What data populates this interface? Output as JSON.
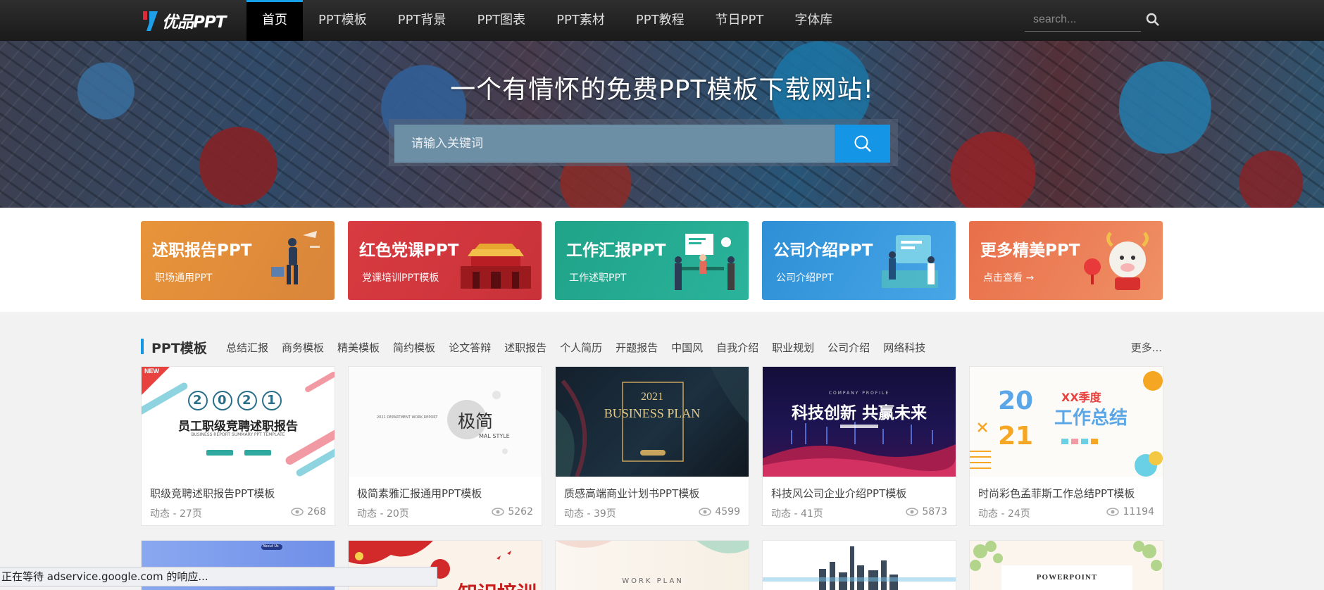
{
  "logo": {
    "text": "优品PPT"
  },
  "nav": {
    "items": [
      {
        "label": "首页"
      },
      {
        "label": "PPT模板"
      },
      {
        "label": "PPT背景"
      },
      {
        "label": "PPT图表"
      },
      {
        "label": "PPT素材"
      },
      {
        "label": "PPT教程"
      },
      {
        "label": "节日PPT"
      },
      {
        "label": "字体库"
      }
    ],
    "active_index": 0,
    "search_placeholder": "search..."
  },
  "hero": {
    "title": "一个有情怀的免费PPT模板下载网站!",
    "search_placeholder": "请输入关键词"
  },
  "banners": [
    {
      "title": "述职报告PPT",
      "subtitle": "职场通用PPT"
    },
    {
      "title": "红色党课PPT",
      "subtitle": "党课培训PPT模板"
    },
    {
      "title": "工作汇报PPT",
      "subtitle": "工作述职PPT"
    },
    {
      "title": "公司介绍PPT",
      "subtitle": "公司介绍PPT"
    },
    {
      "title": "更多精美PPT",
      "subtitle": "点击查看 →"
    }
  ],
  "section": {
    "title": "PPT模板",
    "tags": [
      "总结汇报",
      "商务模板",
      "精美模板",
      "简约模板",
      "论文答辩",
      "述职报告",
      "个人简历",
      "开题报告",
      "中国风",
      "自我介绍",
      "职业规划",
      "公司介绍",
      "网络科技"
    ],
    "more": "更多..."
  },
  "cards": [
    {
      "title": "职级竞聘述职报告PPT模板",
      "meta": "动态 - 27页",
      "views": "268",
      "thumb_text": {
        "badge": "NEW",
        "digits": [
          "2",
          "0",
          "2",
          "1"
        ],
        "heading": "员工职级竞聘述职报告",
        "sub": "BUSINESS REPORT SUMMARY PPT TEMPLATE"
      }
    },
    {
      "title": "极简素雅汇报通用PPT模板",
      "meta": "动态 - 20页",
      "views": "5262",
      "thumb_text": {
        "heading": "极简",
        "side": "MAL STYLE",
        "small": "2021 DEPARTMENT WORK REPORT"
      }
    },
    {
      "title": "质感高端商业计划书PPT模板",
      "meta": "动态 - 39页",
      "views": "4599",
      "thumb_text": {
        "year": "2021",
        "heading": "BUSINESS PLAN"
      }
    },
    {
      "title": "科技风公司企业介绍PPT模板",
      "meta": "动态 - 41页",
      "views": "5873",
      "thumb_text": {
        "small": "COMPANY PROFILE",
        "heading": "科技创新 共赢未来"
      }
    },
    {
      "title": "时尚彩色孟菲斯工作总结PPT模板",
      "meta": "动态 - 24页",
      "views": "11194",
      "thumb_text": {
        "heading": "XX季度",
        "sub": "工作总结",
        "digits": [
          "20",
          "21"
        ]
      }
    }
  ],
  "row2": [
    {
      "thumb_text": "About Us"
    },
    {
      "thumb_text": "知识培训"
    },
    {
      "thumb_text": "WORK PLAN"
    },
    {
      "thumb_text": ""
    },
    {
      "thumb_text": "POWERPOINT"
    }
  ],
  "status": {
    "text": "正在等待 adservice.google.com 的响应..."
  },
  "colors": {
    "accent": "#1495e6",
    "nav_bg": "#222222"
  }
}
